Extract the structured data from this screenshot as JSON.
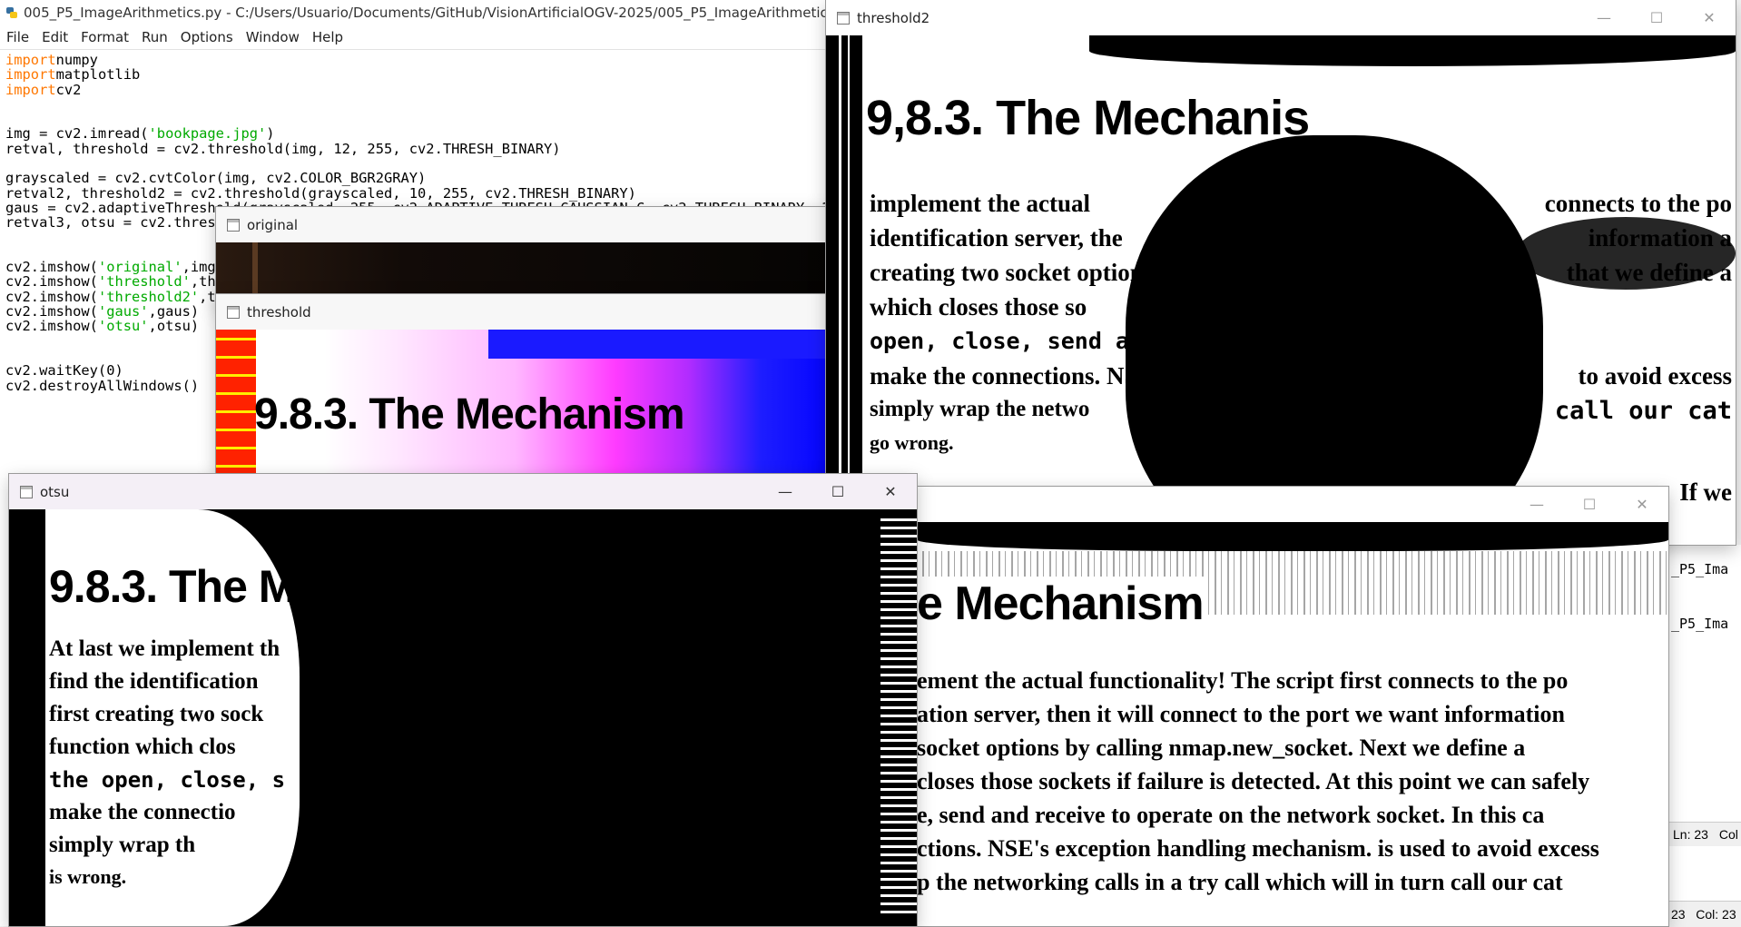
{
  "idle": {
    "title": "005_P5_ImageArithmetics.py - C:/Users/Usuario/Documents/GitHub/VisionArtificialOGV-2025/005_P5_ImageArithmetics/005_P5_Imag",
    "menu": [
      "File",
      "Edit",
      "Format",
      "Run",
      "Options",
      "Window",
      "Help"
    ],
    "status_ln": "Ln: 23",
    "status_col": "Col",
    "status_bottom": "23   Col: 23",
    "shell_lines": [
      "_P5_Ima",
      "_P5_Ima"
    ]
  },
  "windows": {
    "original": {
      "title": "original"
    },
    "threshold": {
      "title": "threshold",
      "heading": "9.8.3. The Mechanism"
    },
    "threshold2": {
      "title": "threshold2",
      "heading": "9,8.3. The Mechanis",
      "lines": [
        "implement the actual",
        "identification server, the",
        "creating two socket option",
        "which closes those so",
        "open, close, send and",
        "make the connections. NSE",
        "simply wrap the netwo",
        "go wrong.",
        "connects to the po",
        "information a",
        "that we define a",
        "we can safely",
        "socket. In this ca",
        "to avoid excess",
        "call our cat",
        "If we"
      ]
    },
    "threshold_back": {
      "heading": "e Mechanism",
      "lines": [
        "ement the actual functionality! The script first connects to the po",
        "ation server, then it will connect to the port we want information",
        "socket options by calling nmap.new_socket. Next we define a",
        "closes those sockets if failure is detected. At this point we can safely",
        "e, send and receive to operate on the network socket. In this ca",
        "ctions. NSE's exception handling mechanism. is used to avoid excess",
        "p the networking calls in a try call which will in turn call our cat"
      ]
    },
    "otsu": {
      "title": "otsu",
      "heading": "9.8.3. The Me",
      "lines": [
        "At last we implement th",
        "find the identification",
        "first creating two sock",
        "function which clos",
        "the open, close, s",
        "make the connectio",
        "simply wrap th",
        "is wrong."
      ]
    }
  },
  "code": [
    [
      [
        "kw",
        "import"
      ],
      [
        "",
        "numpy"
      ]
    ],
    [
      [
        "kw",
        "import"
      ],
      [
        "",
        "matplotlib"
      ]
    ],
    [
      [
        "kw",
        "import"
      ],
      [
        "",
        "cv2"
      ]
    ],
    [],
    [],
    [
      [
        "",
        "img = cv2.imread("
      ],
      [
        "str",
        "'bookpage.jpg'"
      ],
      [
        "",
        ")"
      ]
    ],
    [
      [
        "",
        "retval, threshold = cv2.threshold(img, 12, 255, cv2.THRESH_BINARY)"
      ]
    ],
    [],
    [
      [
        "",
        "grayscaled = cv2.cvtColor(img, cv2.COLOR_BGR2GRAY)"
      ]
    ],
    [
      [
        "",
        "retval2, threshold2 = cv2.threshold(grayscaled, 10, 255, cv2.THRESH_BINARY)"
      ]
    ],
    [
      [
        "",
        "gaus = cv2.adaptiveThreshold(grayscaled, 255, cv2.ADAPTIVE_THRESH_GAUSSIAN_C, cv2.THRESH_BINARY, 115, 1)"
      ]
    ],
    [
      [
        "",
        "retval3, otsu = cv2.threshold(grayscaled, 125, 255, cv2.THRESH_BINARY+cv2.THRESH_OTSU)"
      ]
    ],
    [],
    [],
    [
      [
        "",
        "cv2.imshow("
      ],
      [
        "str",
        "'original'"
      ],
      [
        "",
        ",img)"
      ]
    ],
    [
      [
        "",
        "cv2.imshow("
      ],
      [
        "str",
        "'threshold'"
      ],
      [
        "",
        ",threshold)"
      ]
    ],
    [
      [
        "",
        "cv2.imshow("
      ],
      [
        "str",
        "'threshold2'"
      ],
      [
        "",
        ",threshold2)"
      ]
    ],
    [
      [
        "",
        "cv2.imshow("
      ],
      [
        "str",
        "'gaus'"
      ],
      [
        "",
        ",gaus)"
      ]
    ],
    [
      [
        "",
        "cv2.imshow("
      ],
      [
        "str",
        "'otsu'"
      ],
      [
        "",
        ",otsu)"
      ]
    ],
    [],
    [],
    [
      [
        "",
        "cv2.waitKey(0)"
      ]
    ],
    [
      [
        "",
        "cv2.destroyAllWindows()"
      ]
    ]
  ],
  "controls": {
    "minimize": "—",
    "maximize": "☐",
    "close": "✕"
  }
}
